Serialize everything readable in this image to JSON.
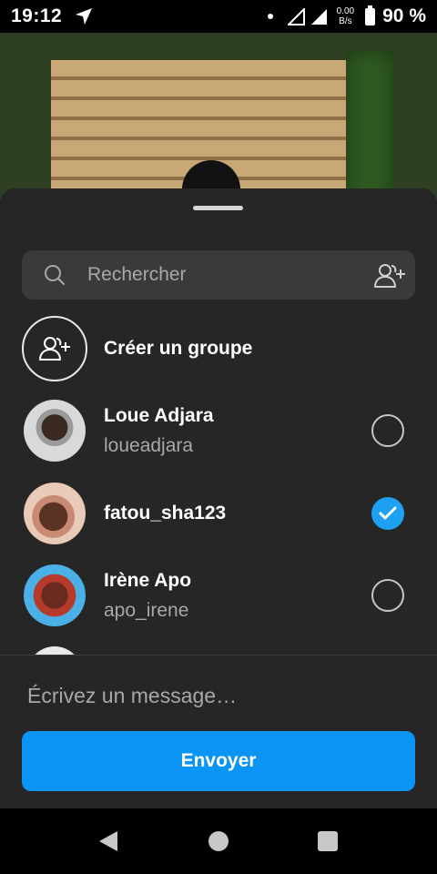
{
  "status_bar": {
    "time": "19:12",
    "net_speed_value": "0.00",
    "net_speed_unit": "B/s",
    "battery_percent": "90 %"
  },
  "share_sheet": {
    "search_placeholder": "Rechercher",
    "create_group_label": "Créer un groupe",
    "contacts": [
      {
        "name": "Loue Adjara",
        "username": "loueadjara",
        "selected": false
      },
      {
        "name": "fatou_sha123",
        "username": "",
        "selected": true
      },
      {
        "name": "Irène Apo",
        "username": "apo_irene",
        "selected": false
      }
    ],
    "message_placeholder": "Écrivez un message…",
    "send_label": "Envoyer"
  },
  "colors": {
    "sheet_bg": "#262626",
    "accent_blue": "#0a95f6",
    "check_blue": "#1ea1f3",
    "muted_text": "#a8a8a8"
  },
  "icons": {
    "status": [
      "navigation-arrow-icon",
      "signal-icon",
      "battery-icon"
    ],
    "sheet": [
      "search-icon",
      "add-people-icon",
      "create-group-icon",
      "checkmark-icon"
    ],
    "nav": [
      "back-icon",
      "home-icon",
      "recents-icon"
    ]
  }
}
